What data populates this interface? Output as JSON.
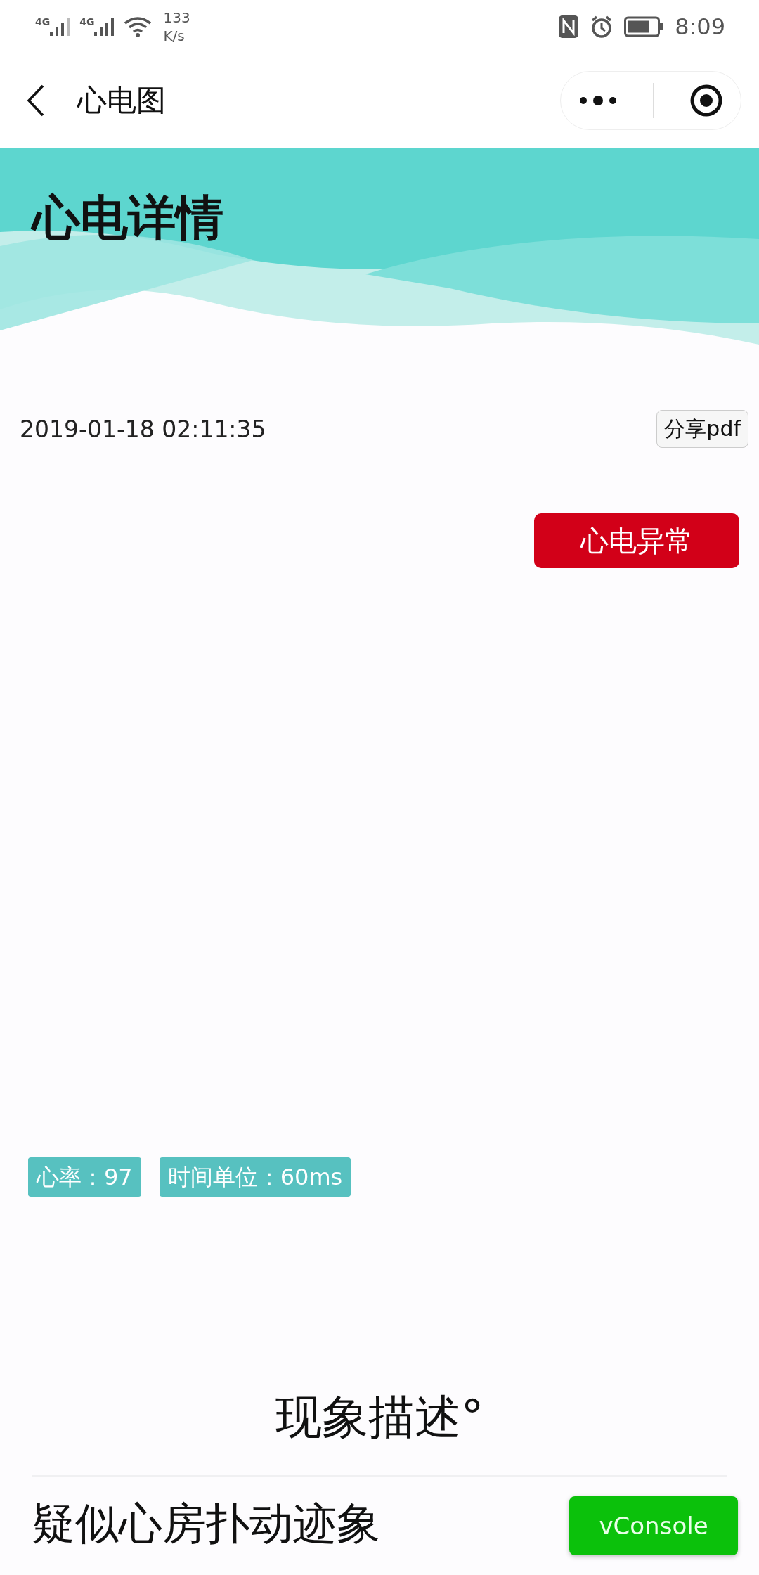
{
  "status_bar": {
    "signal_labels": [
      "4G",
      "4G"
    ],
    "network_speed": "133",
    "network_speed_unit": "K/s",
    "time": "8:09"
  },
  "nav": {
    "title": "心电图"
  },
  "banner": {
    "title": "心电详情"
  },
  "record": {
    "datetime": "2019-01-18 02:11:35",
    "share_button": "分享pdf",
    "result_badge": "心电异常"
  },
  "tags": [
    {
      "label": "心率：97"
    },
    {
      "label": "时间单位：60ms"
    }
  ],
  "description": {
    "heading": "现象描述°",
    "text": "疑似心房扑动迹象"
  },
  "console_button": "vConsole"
}
